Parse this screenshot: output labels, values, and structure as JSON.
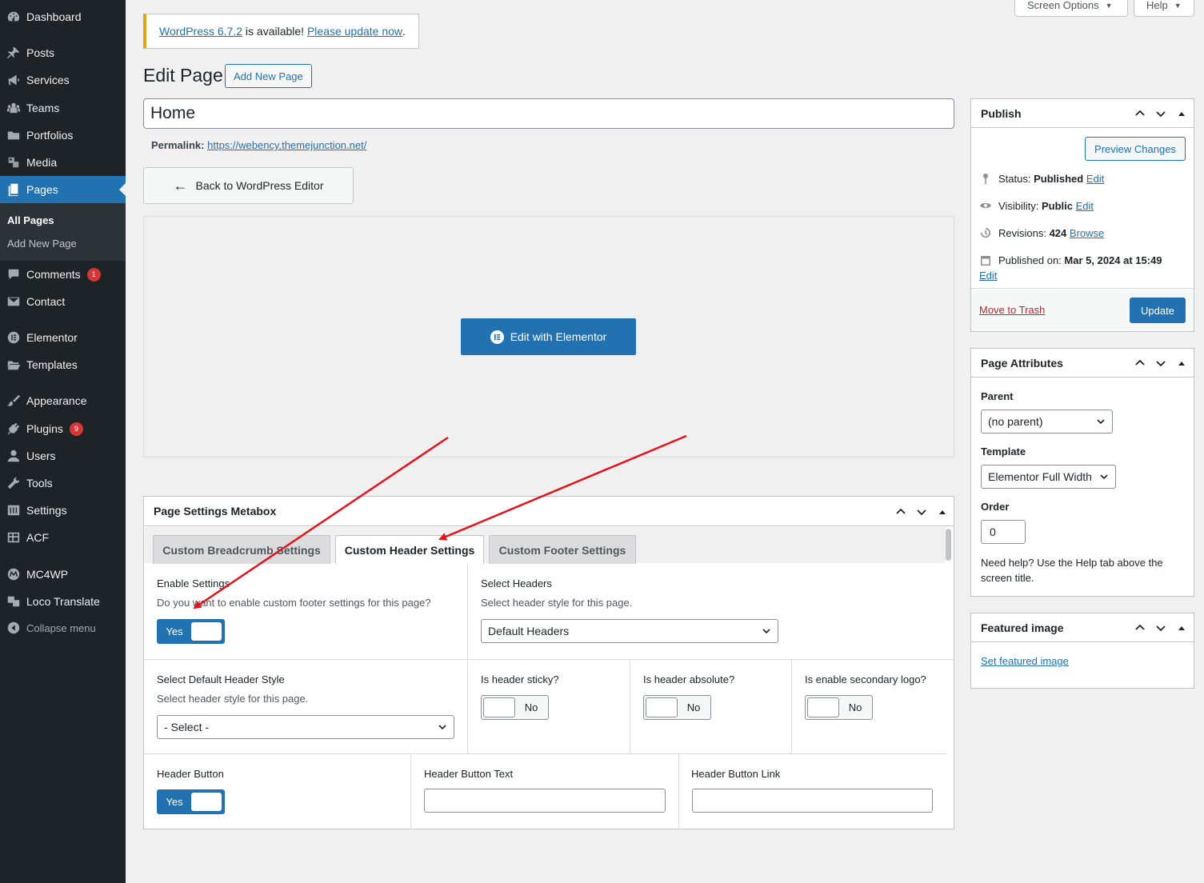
{
  "sidebar": {
    "items": [
      {
        "label": "Dashboard",
        "icon": "dashboard-icon"
      },
      {
        "label": "Posts",
        "icon": "pin-icon"
      },
      {
        "label": "Services",
        "icon": "megaphone-icon"
      },
      {
        "label": "Teams",
        "icon": "groups-icon"
      },
      {
        "label": "Portfolios",
        "icon": "folder-icon"
      },
      {
        "label": "Media",
        "icon": "media-icon"
      },
      {
        "label": "Pages",
        "icon": "page-icon"
      },
      {
        "label": "Comments",
        "icon": "comment-icon",
        "badge": "1"
      },
      {
        "label": "Contact",
        "icon": "mail-icon"
      },
      {
        "label": "Elementor",
        "icon": "elementor-icon"
      },
      {
        "label": "Templates",
        "icon": "folder-open-icon"
      },
      {
        "label": "Appearance",
        "icon": "brush-icon"
      },
      {
        "label": "Plugins",
        "icon": "plugin-icon",
        "badge": "9"
      },
      {
        "label": "Users",
        "icon": "user-icon"
      },
      {
        "label": "Tools",
        "icon": "wrench-icon"
      },
      {
        "label": "Settings",
        "icon": "sliders-icon"
      },
      {
        "label": "ACF",
        "icon": "grid-icon"
      },
      {
        "label": "MC4WP",
        "icon": "mc4wp-icon"
      },
      {
        "label": "Loco Translate",
        "icon": "translate-icon"
      },
      {
        "label": "Collapse menu",
        "icon": "collapse-icon"
      }
    ],
    "submenu": [
      "All Pages",
      "Add New Page"
    ]
  },
  "topbar": {
    "screen_options": "Screen Options",
    "help": "Help"
  },
  "notice": {
    "link1": "WordPress 6.7.2",
    "middle": " is available! ",
    "link2": "Please update now",
    "end": "."
  },
  "header": {
    "title": "Edit Page",
    "add_new": "Add New Page"
  },
  "post": {
    "title": "Home",
    "permalink_label": "Permalink:",
    "permalink_url": "https://webency.themejunction.net/",
    "back_btn": "Back to WordPress Editor",
    "elementor_btn": "Edit with Elementor"
  },
  "metabox": {
    "title": "Page Settings Metabox",
    "tabs": [
      "Custom Breadcrumb Settings",
      "Custom Header Settings",
      "Custom Footer Settings"
    ],
    "active_tab": "Custom Header Settings",
    "enable": {
      "label": "Enable Settings",
      "desc": "Do you want to enable custom footer settings for this page?",
      "value": "Yes"
    },
    "select_headers": {
      "label": "Select Headers",
      "desc": "Select header style for this page.",
      "value": "Default Headers"
    },
    "default_style": {
      "label": "Select Default Header Style",
      "desc": "Select header style for this page.",
      "value": "- Select -"
    },
    "sticky": {
      "label": "Is header sticky?",
      "value": "No"
    },
    "absolute": {
      "label": "Is header absolute?",
      "value": "No"
    },
    "secondary_logo": {
      "label": "Is enable secondary logo?",
      "value": "No"
    },
    "header_button": {
      "label": "Header Button",
      "value": "Yes"
    },
    "button_text": {
      "label": "Header Button Text",
      "value": ""
    },
    "button_link": {
      "label": "Header Button Link",
      "value": ""
    }
  },
  "publish": {
    "title": "Publish",
    "preview": "Preview Changes",
    "status_label": "Status: ",
    "status_value": "Published",
    "status_edit": "Edit",
    "visibility_label": "Visibility: ",
    "visibility_value": "Public",
    "visibility_edit": "Edit",
    "revisions_label": "Revisions: ",
    "revisions_value": "424",
    "revisions_browse": "Browse",
    "published_label": "Published on: ",
    "published_value": "Mar 5, 2024 at 15:49",
    "published_edit": "Edit",
    "trash": "Move to Trash",
    "update": "Update"
  },
  "attributes": {
    "title": "Page Attributes",
    "parent_label": "Parent",
    "parent_value": "(no parent)",
    "template_label": "Template",
    "template_value": "Elementor Full Width",
    "order_label": "Order",
    "order_value": "0",
    "help": "Need help? Use the Help tab above the screen title."
  },
  "featured": {
    "title": "Featured image",
    "link": "Set featured image"
  },
  "colors": {
    "accent": "#2271b1",
    "sidebar": "#1d2327",
    "annotation_arrow": "#e3141b",
    "badge": "#d63638"
  }
}
